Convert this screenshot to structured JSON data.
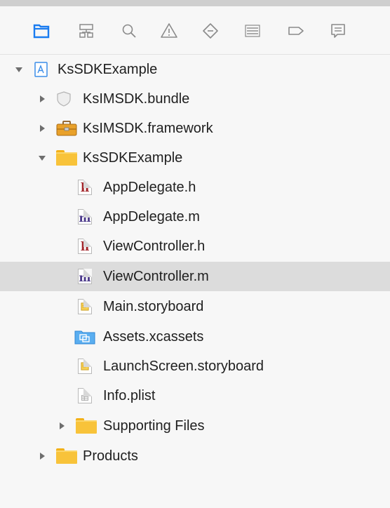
{
  "navigator": {
    "toolbar": [
      {
        "name": "project-navigator-icon",
        "active": true
      },
      {
        "name": "symbol-navigator-icon"
      },
      {
        "name": "find-navigator-icon"
      },
      {
        "name": "issue-navigator-icon"
      },
      {
        "name": "test-navigator-icon"
      },
      {
        "name": "debug-navigator-icon"
      },
      {
        "name": "breakpoint-navigator-icon"
      },
      {
        "name": "report-navigator-icon"
      }
    ],
    "accent_color": "#1a7cf0",
    "selected_row_color": "#dcdcdc",
    "tree": [
      {
        "label": "KsSDKExample",
        "icon": "xcode-project-icon",
        "expanded": true
      },
      {
        "label": "KsIMSDK.bundle",
        "icon": "bundle-icon",
        "expanded": false
      },
      {
        "label": "KsIMSDK.framework",
        "icon": "framework-toolbox-icon",
        "expanded": false
      },
      {
        "label": "KsSDKExample",
        "icon": "folder-icon",
        "expanded": true
      },
      {
        "label": "AppDelegate.h",
        "icon": "header-file-icon"
      },
      {
        "label": "AppDelegate.m",
        "icon": "objc-source-file-icon"
      },
      {
        "label": "ViewController.h",
        "icon": "header-file-icon"
      },
      {
        "label": "ViewController.m",
        "icon": "objc-source-file-icon",
        "selected": true
      },
      {
        "label": "Main.storyboard",
        "icon": "storyboard-file-icon"
      },
      {
        "label": "Assets.xcassets",
        "icon": "asset-catalog-icon"
      },
      {
        "label": "LaunchScreen.storyboard",
        "icon": "storyboard-file-icon"
      },
      {
        "label": "Info.plist",
        "icon": "plist-file-icon"
      },
      {
        "label": "Supporting Files",
        "icon": "folder-icon",
        "expanded": false
      },
      {
        "label": "Products",
        "icon": "folder-icon",
        "expanded": false
      }
    ]
  }
}
